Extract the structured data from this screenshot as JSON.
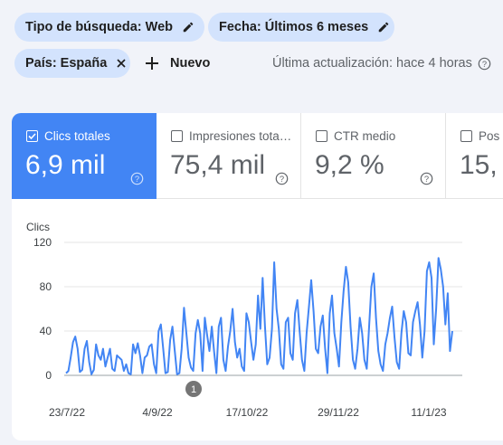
{
  "filters": {
    "search_type": "Tipo de búsqueda: Web",
    "date": "Fecha: Últimos 6 meses",
    "country": "País: España",
    "new_label": "Nuevo",
    "last_update": "Última actualización: hace 4 horas"
  },
  "metrics": [
    {
      "label": "Clics totales",
      "value": "6,9 mil",
      "active": true
    },
    {
      "label": "Impresiones tota…",
      "value": "75,4 mil",
      "active": false
    },
    {
      "label": "CTR medio",
      "value": "9,2 %",
      "active": false
    },
    {
      "label": "Pos",
      "value": "15,",
      "active": false
    }
  ],
  "colors": {
    "accent": "#4285f4",
    "chip_bg": "#d3e3fd"
  },
  "annotation_marker": "1",
  "chart_data": {
    "type": "line",
    "ylabel": "Clics",
    "ylim": [
      0,
      120
    ],
    "yticks": [
      "0",
      "40",
      "80",
      "120"
    ],
    "xtick_labels": [
      "23/7/22",
      "4/9/22",
      "17/10/22",
      "29/11/22",
      "11/1/23"
    ],
    "series": [
      {
        "color": "#4285f4",
        "values": [
          2,
          4,
          16,
          30,
          35,
          24,
          3,
          5,
          24,
          31,
          12,
          1,
          5,
          28,
          18,
          14,
          24,
          8,
          16,
          24,
          6,
          4,
          18,
          16,
          14,
          4,
          10,
          2,
          1,
          28,
          20,
          29,
          18,
          2,
          16,
          18,
          26,
          28,
          10,
          2,
          40,
          46,
          24,
          2,
          3,
          32,
          44,
          22,
          1,
          2,
          24,
          61,
          38,
          16,
          7,
          4,
          38,
          50,
          38,
          4,
          52,
          36,
          22,
          44,
          22,
          2,
          44,
          52,
          14,
          4,
          26,
          40,
          60,
          30,
          16,
          24,
          8,
          4,
          56,
          48,
          30,
          14,
          28,
          72,
          42,
          88,
          44,
          10,
          16,
          42,
          102,
          60,
          42,
          10,
          6,
          48,
          52,
          20,
          14,
          56,
          68,
          40,
          14,
          4,
          38,
          62,
          86,
          58,
          24,
          20,
          44,
          54,
          24,
          2,
          56,
          72,
          38,
          24,
          8,
          48,
          76,
          98,
          84,
          44,
          14,
          6,
          24,
          52,
          38,
          14,
          6,
          44,
          80,
          92,
          52,
          22,
          10,
          4,
          28,
          38,
          52,
          62,
          34,
          12,
          6,
          38,
          58,
          48,
          20,
          18,
          48,
          58,
          66,
          46,
          16,
          40,
          94,
          102,
          88,
          28,
          60,
          106,
          96,
          80,
          46,
          74,
          22,
          40
        ]
      }
    ]
  }
}
